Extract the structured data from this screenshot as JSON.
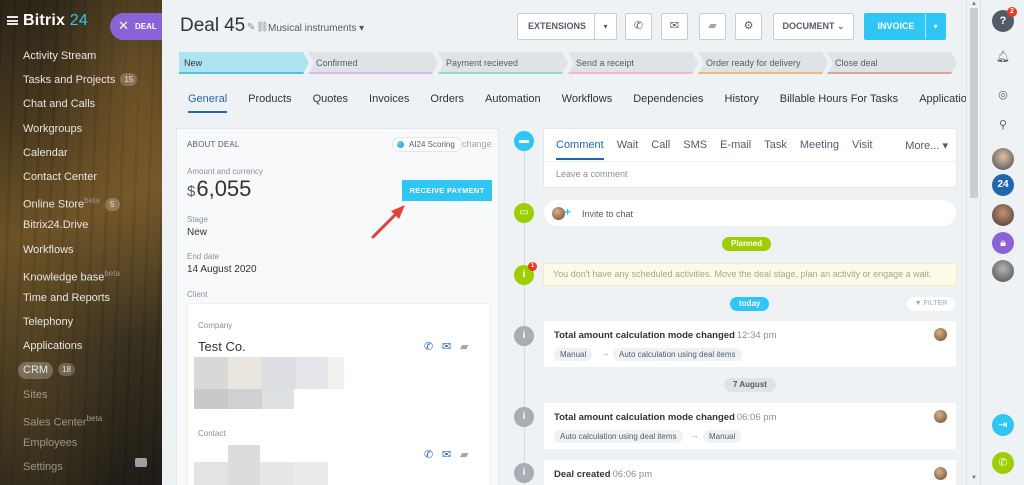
{
  "sidebar": {
    "brand": "Bitrix",
    "brand_num": "24",
    "deal_tab": "DEAL",
    "items": [
      {
        "label": "Activity Stream",
        "count": "",
        "sup": ""
      },
      {
        "label": "Tasks and Projects",
        "count": "15",
        "sup": ""
      },
      {
        "label": "Chat and Calls",
        "count": "",
        "sup": ""
      },
      {
        "label": "Workgroups",
        "count": "",
        "sup": ""
      },
      {
        "label": "Calendar",
        "count": "",
        "sup": ""
      },
      {
        "label": "Contact Center",
        "count": "",
        "sup": ""
      },
      {
        "label": "Online Store",
        "count": "5",
        "sup": "beta"
      },
      {
        "label": "Bitrix24.Drive",
        "count": "",
        "sup": ""
      },
      {
        "label": "Workflows",
        "count": "",
        "sup": ""
      },
      {
        "label": "Knowledge base",
        "count": "",
        "sup": "beta"
      },
      {
        "label": "Time and Reports",
        "count": "",
        "sup": ""
      },
      {
        "label": "Telephony",
        "count": "",
        "sup": ""
      },
      {
        "label": "Applications",
        "count": "",
        "sup": ""
      },
      {
        "label": "CRM",
        "count": "18",
        "sup": ""
      },
      {
        "label": "Sites",
        "count": "",
        "sup": ""
      },
      {
        "label": "Sales Center",
        "count": "",
        "sup": "beta"
      },
      {
        "label": "Employees",
        "count": "",
        "sup": ""
      },
      {
        "label": "Settings",
        "count": "",
        "sup": ""
      }
    ]
  },
  "header": {
    "title": "Deal",
    "number": "45",
    "category": "Musical instruments",
    "extensions": "EXTENSIONS",
    "document": "DOCUMENT",
    "invoice": "INVOICE"
  },
  "stages": [
    "New",
    "Confirmed",
    "Payment recieved",
    "Send a receipt",
    "Order ready for delivery",
    "Close deal"
  ],
  "tabs": [
    "General",
    "Products",
    "Quotes",
    "Invoices",
    "Orders",
    "Automation",
    "Workflows",
    "Dependencies",
    "History",
    "Billable Hours For Tasks",
    "Applications"
  ],
  "about": {
    "heading": "ABOUT DEAL",
    "ai_label": "AI24 Scoring",
    "change": "change",
    "amount_label": "Amount and currency",
    "currency": "$",
    "amount": "6,055",
    "pay_button": "RECEIVE PAYMENT",
    "stage_label": "Stage",
    "stage_value": "New",
    "end_label": "End date",
    "end_value": "14 August 2020",
    "client_label": "Client",
    "company_label": "Company",
    "company_name": "Test Co.",
    "contact_label": "Contact"
  },
  "timeline": {
    "editor_tabs": [
      "Comment",
      "Wait",
      "Call",
      "SMS",
      "E-mail",
      "Task",
      "Meeting",
      "Visit"
    ],
    "more": "More...",
    "placeholder": "Leave a comment",
    "invite": "Invite to chat",
    "planned": "Planned",
    "notice": "You don't have any scheduled activities. Move the deal stage, plan an activity or engage a wait.",
    "notice_badge": "1",
    "today": "today",
    "filter": "FILTER",
    "date_sep": "7 August",
    "entries": [
      {
        "title": "Total amount calculation mode changed",
        "time": "12:34 pm",
        "from": "Manual",
        "to": "Auto calculation using deal items"
      },
      {
        "title": "Total amount calculation mode changed",
        "time": "06:06 pm",
        "from": "Auto calculation using deal items",
        "to": "Manual"
      },
      {
        "title": "Deal created",
        "time": "06:06 pm",
        "from": "",
        "to": ""
      }
    ]
  },
  "rightbar": {
    "help_badge": "2",
    "b24": "24"
  },
  "colors": {
    "accent": "#2fc6f6",
    "link": "#2067b0",
    "green": "#9dcf00",
    "deal_tab": "#8b63d6",
    "arrow": "#e0423a"
  }
}
